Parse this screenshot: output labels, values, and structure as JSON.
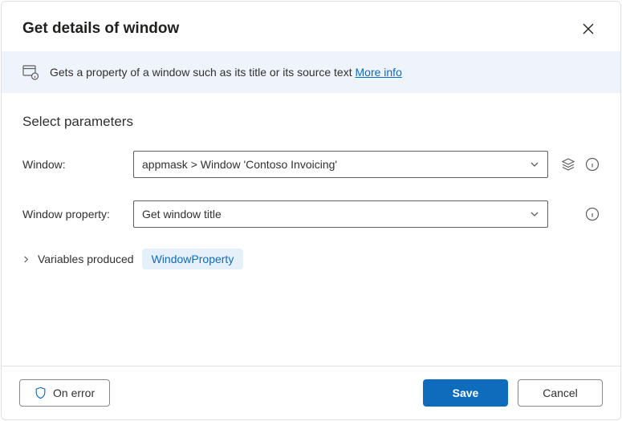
{
  "header": {
    "title": "Get details of window"
  },
  "banner": {
    "text": "Gets a property of a window such as its title or its source text ",
    "more_link": "More info"
  },
  "section": {
    "title": "Select parameters",
    "fields": {
      "window": {
        "label": "Window:",
        "value": "appmask > Window 'Contoso Invoicing'"
      },
      "window_property": {
        "label": "Window property:",
        "value": "Get window title"
      }
    },
    "variables": {
      "label": "Variables produced",
      "badge": "WindowProperty"
    }
  },
  "footer": {
    "on_error": "On error",
    "save": "Save",
    "cancel": "Cancel"
  }
}
